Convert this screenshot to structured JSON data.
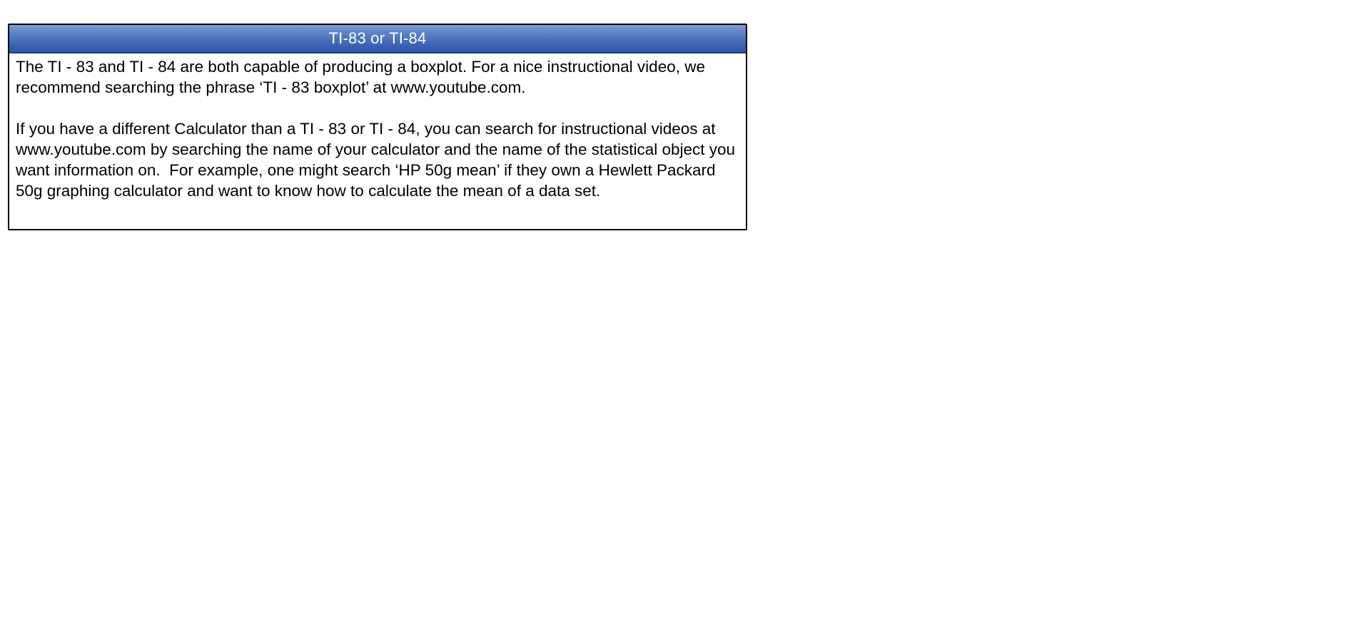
{
  "box": {
    "title": "TI-83 or TI-84",
    "paragraphs": [
      "The TI - 83 and TI - 84 are both capable of producing a boxplot.  For a nice instructional video, we recommend searching the phrase ‘TI - 83 boxplot’ at www.youtube.com.",
      "If you have a different Calculator than a TI - 83 or TI - 84, you can search for instructional videos at www.youtube.com by searching the name of your calculator and the name of the statistical object you want information on.  For example, one might search ‘HP 50g mean’ if they own a Hewlett Packard 50g graphing calculator and want to know how to calculate the mean of a data set."
    ]
  },
  "colors": {
    "header_gradient_top": "#7d9bd0",
    "header_gradient_bottom": "#2e55a6",
    "header_text": "#ffffff",
    "border": "#000000",
    "body_text": "#000000"
  }
}
